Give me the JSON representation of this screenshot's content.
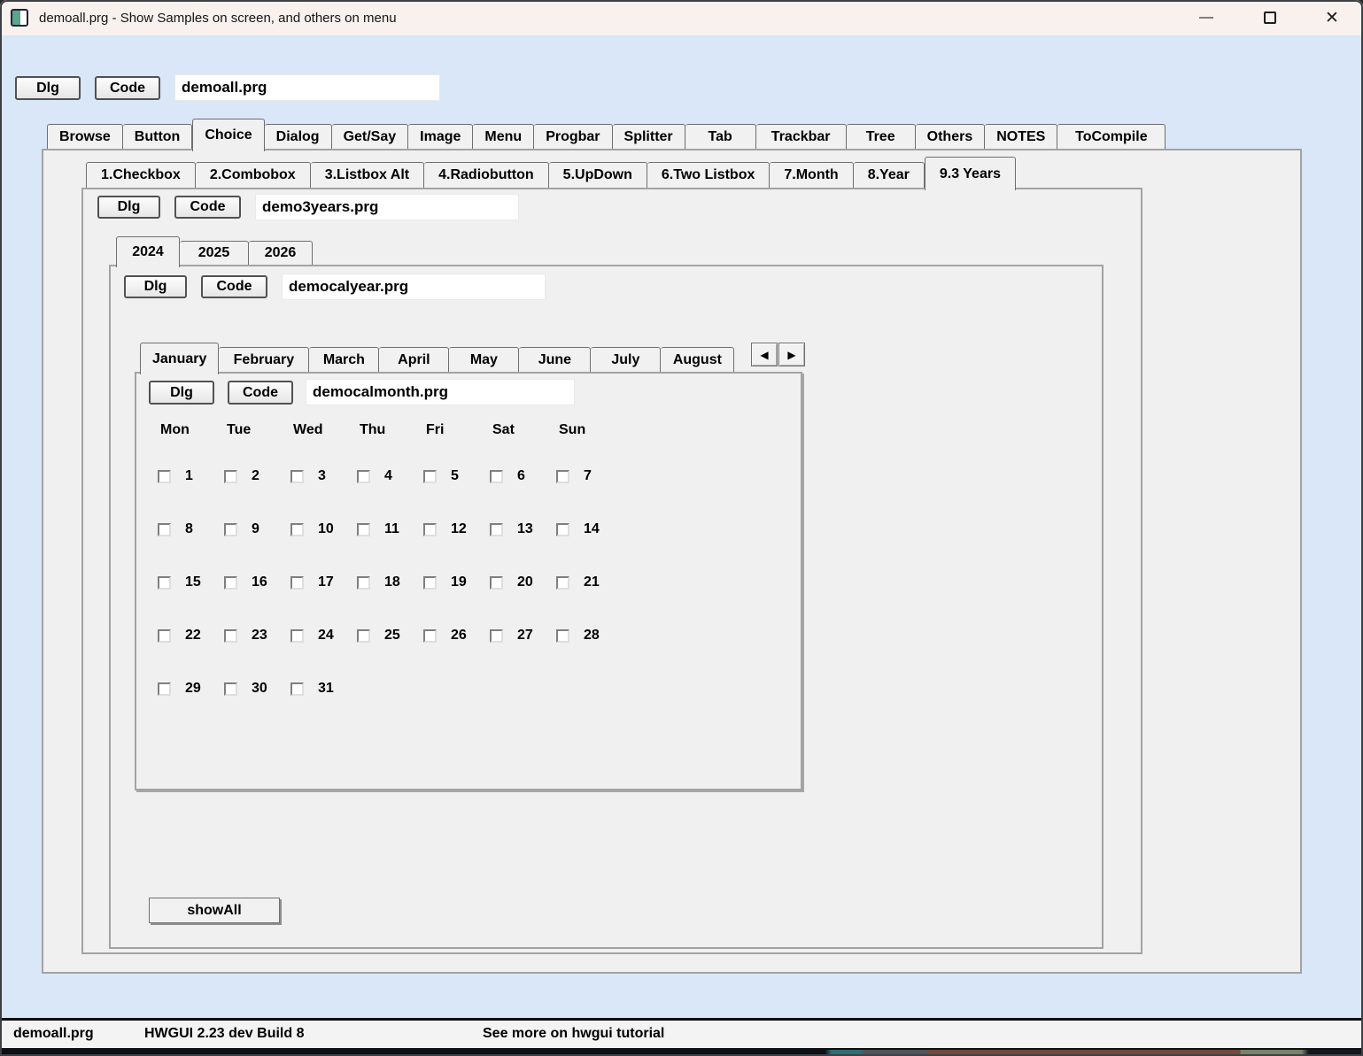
{
  "window": {
    "title": "demoall.prg - Show Samples on screen, and others on menu",
    "minimize_glyph": "—",
    "close_glyph": "✕"
  },
  "toolbars": {
    "main": {
      "dlg": "Dlg",
      "code": "Code",
      "file": "demoall.prg"
    },
    "three_years": {
      "dlg": "Dlg",
      "code": "Code",
      "file": "demo3years.prg"
    },
    "year": {
      "dlg": "Dlg",
      "code": "Code",
      "file": "democalyear.prg"
    },
    "month": {
      "dlg": "Dlg",
      "code": "Code",
      "file": "democalmonth.prg"
    }
  },
  "tabs": {
    "main": {
      "items": [
        "Browse",
        "Button",
        "Choice",
        "Dialog",
        "Get/Say",
        "Image",
        "Menu",
        "Progbar",
        "Splitter",
        "Tab",
        "Trackbar",
        "Tree",
        "Others",
        "NOTES",
        "ToCompile"
      ],
      "selected": "Choice"
    },
    "samples": {
      "items": [
        "1.Checkbox",
        "2.Combobox",
        "3.Listbox Alt",
        "4.Radiobutton",
        "5.UpDown",
        "6.Two Listbox",
        "7.Month",
        "8.Year",
        "9.3 Years"
      ],
      "selected": "9.3 Years"
    },
    "years": {
      "items": [
        "2024",
        "2025",
        "2026"
      ],
      "selected": "2024"
    },
    "months": {
      "items": [
        "January",
        "February",
        "March",
        "April",
        "May",
        "June",
        "July",
        "August"
      ],
      "selected": "January",
      "scroll_left": "◀",
      "scroll_right": "▶"
    }
  },
  "calendar": {
    "weekdays": [
      "Mon",
      "Tue",
      "Wed",
      "Thu",
      "Fri",
      "Sat",
      "Sun"
    ],
    "weeks": [
      [
        "1",
        "2",
        "3",
        "4",
        "5",
        "6",
        "7"
      ],
      [
        "8",
        "9",
        "10",
        "11",
        "12",
        "13",
        "14"
      ],
      [
        "15",
        "16",
        "17",
        "18",
        "19",
        "20",
        "21"
      ],
      [
        "22",
        "23",
        "24",
        "25",
        "26",
        "27",
        "28"
      ],
      [
        "29",
        "30",
        "31"
      ]
    ],
    "checked_days": []
  },
  "show_all": {
    "label": "showAll"
  },
  "statusbar": {
    "file": "demoall.prg",
    "version": "HWGUI 2.23 dev Build 8",
    "note": "See more on hwgui tutorial"
  },
  "colors": {
    "window_bg": "#d9e7f8",
    "titlebar_bg": "#f8f1ee",
    "panel_bg": "#f0f0f0",
    "statusbar_bg": "#f3f3f3"
  }
}
